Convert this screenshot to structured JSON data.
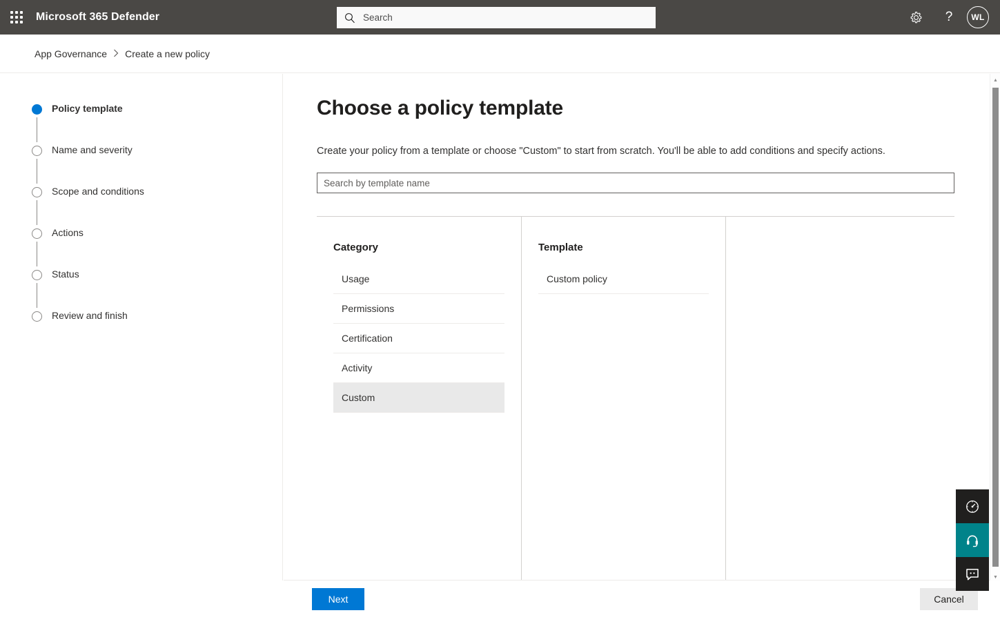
{
  "suite": {
    "waffle_icon": "waffle-grid-icon",
    "title": "Microsoft 365 Defender",
    "search": {
      "icon": "search-icon",
      "placeholder": "Search",
      "value": ""
    },
    "settings_icon": "gear-icon",
    "help_icon": "question-mark-icon",
    "help_label": "?",
    "avatar_initials": "WL"
  },
  "breadcrumb": {
    "items": [
      {
        "label": "App Governance"
      },
      {
        "label": "Create a new policy"
      }
    ],
    "separator": "›",
    "separator_icon": "chevron-right-icon"
  },
  "wizard": {
    "steps": [
      {
        "label": "Policy template",
        "active": true
      },
      {
        "label": "Name and severity",
        "active": false
      },
      {
        "label": "Scope and conditions",
        "active": false
      },
      {
        "label": "Actions",
        "active": false
      },
      {
        "label": "Status",
        "active": false
      },
      {
        "label": "Review and finish",
        "active": false
      }
    ]
  },
  "main": {
    "title": "Choose a policy template",
    "description": "Create your policy from a template or choose \"Custom\" to start from scratch. You'll be able to add conditions and specify actions.",
    "template_search": {
      "placeholder": "Search by template name",
      "value": ""
    },
    "picker": {
      "category": {
        "heading": "Category",
        "options": [
          {
            "label": "Usage",
            "selected": false
          },
          {
            "label": "Permissions",
            "selected": false
          },
          {
            "label": "Certification",
            "selected": false
          },
          {
            "label": "Activity",
            "selected": false
          },
          {
            "label": "Custom",
            "selected": true
          }
        ]
      },
      "template": {
        "heading": "Template",
        "options": [
          {
            "label": "Custom policy",
            "selected": false
          }
        ]
      },
      "details": {
        "heading": "",
        "options": []
      }
    }
  },
  "footer": {
    "next_label": "Next",
    "cancel_label": "Cancel"
  },
  "scrollbar": {
    "up_arrow_icon": "scroll-up-arrow-icon",
    "down_arrow_icon": "scroll-down-arrow-icon",
    "up_glyph": "▲",
    "down_glyph": "▼"
  },
  "side_widgets": [
    {
      "icon": "gauge-icon",
      "style": "dark"
    },
    {
      "icon": "headset-support-icon",
      "style": "teal"
    },
    {
      "icon": "feedback-chat-icon",
      "style": "dark"
    }
  ],
  "colors": {
    "suite_bar": "#4a4845",
    "accent": "#0078d4",
    "selected_row": "#e9e9e9",
    "teal_widget": "#00838a",
    "dark_widget": "#201f1e"
  }
}
